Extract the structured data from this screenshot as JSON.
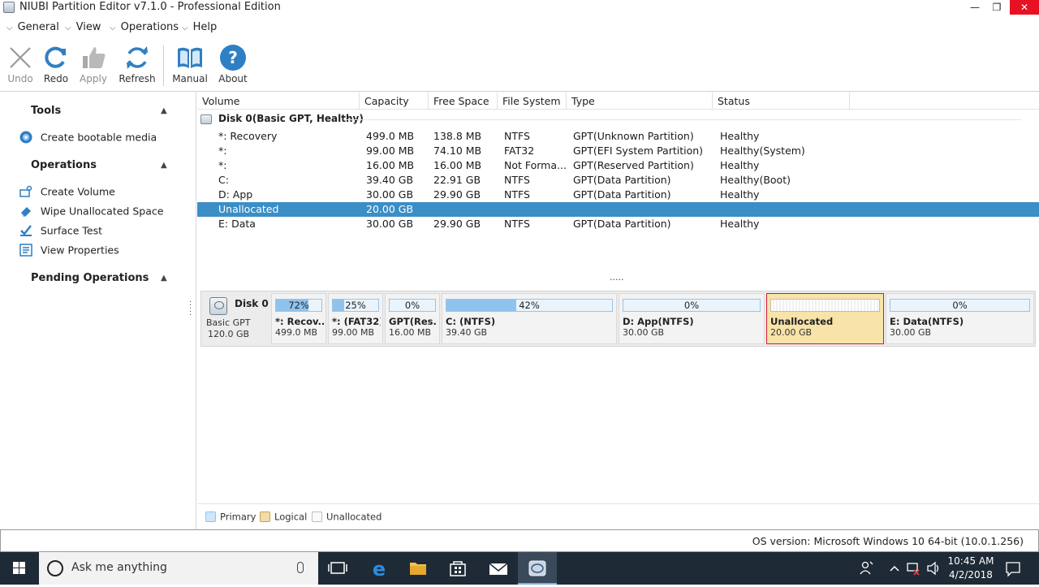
{
  "window": {
    "title": "NIUBI Partition Editor v7.1.0 - Professional Edition"
  },
  "menu": [
    "General",
    "View",
    "Operations",
    "Help"
  ],
  "toolbar": {
    "undo": "Undo",
    "redo": "Redo",
    "apply": "Apply",
    "refresh": "Refresh",
    "manual": "Manual",
    "about": "About"
  },
  "sidebar": {
    "tools_title": "Tools",
    "create_bootable": "Create bootable media",
    "operations_title": "Operations",
    "operations": [
      "Create Volume",
      "Wipe Unallocated Space",
      "Surface Test",
      "View Properties"
    ],
    "pending_title": "Pending Operations"
  },
  "table": {
    "headers": [
      "Volume",
      "Capacity",
      "Free Space",
      "File System",
      "Type",
      "Status"
    ],
    "disk_label": "Disk 0(Basic GPT, Healthy)",
    "rows": [
      [
        "*: Recovery",
        "499.0 MB",
        "138.8 MB",
        "NTFS",
        "GPT(Unknown Partition)",
        "Healthy"
      ],
      [
        "*:",
        "99.00 MB",
        "74.10 MB",
        "FAT32",
        "GPT(EFI System Partition)",
        "Healthy(System)"
      ],
      [
        "*:",
        "16.00 MB",
        "16.00 MB",
        "Not Forma...",
        "GPT(Reserved Partition)",
        "Healthy"
      ],
      [
        "C:",
        "39.40 GB",
        "22.91 GB",
        "NTFS",
        "GPT(Data Partition)",
        "Healthy(Boot)"
      ],
      [
        "D: App",
        "30.00 GB",
        "29.90 GB",
        "NTFS",
        "GPT(Data Partition)",
        "Healthy"
      ],
      [
        "Unallocated",
        "20.00 GB",
        "",
        "",
        "",
        ""
      ],
      [
        "E: Data",
        "30.00 GB",
        "29.90 GB",
        "NTFS",
        "GPT(Data Partition)",
        "Healthy"
      ]
    ],
    "selected_row": 5,
    "more": "....."
  },
  "diskmap": {
    "disk_name": "Disk 0",
    "disk_type": "Basic GPT",
    "disk_size": "120.0 GB",
    "partitions": [
      {
        "pct": "72%",
        "used": 0.72,
        "name": "*: Recov...",
        "size": "499.0 MB"
      },
      {
        "pct": "25%",
        "used": 0.25,
        "name": "*: (FAT32)",
        "size": "99.00 MB"
      },
      {
        "pct": "0%",
        "used": 0.0,
        "name": "GPT(Res...",
        "size": "16.00 MB"
      },
      {
        "pct": "42%",
        "used": 0.42,
        "name": "C: (NTFS)",
        "size": "39.40 GB"
      },
      {
        "pct": "0%",
        "used": 0.0,
        "name": "D: App(NTFS)",
        "size": "30.00 GB"
      },
      {
        "pct": "",
        "used": 0.0,
        "name": "Unallocated",
        "size": "20.00 GB"
      },
      {
        "pct": "0%",
        "used": 0.0,
        "name": "E: Data(NTFS)",
        "size": "30.00 GB"
      }
    ]
  },
  "legend": [
    "Primary",
    "Logical",
    "Unallocated"
  ],
  "status": {
    "os": "OS version: Microsoft Windows 10  64-bit  (10.0.1.256)"
  },
  "taskbar": {
    "search_placeholder": "Ask me anything",
    "time": "10:45 AM",
    "date": "4/2/2018"
  },
  "colors": {
    "selection": "#3b8ec6",
    "primary": "#8fc3ee",
    "logical": "#e7c98c",
    "unallocated_bg": "#f8e3a9",
    "accent_red": "#d6192c"
  }
}
